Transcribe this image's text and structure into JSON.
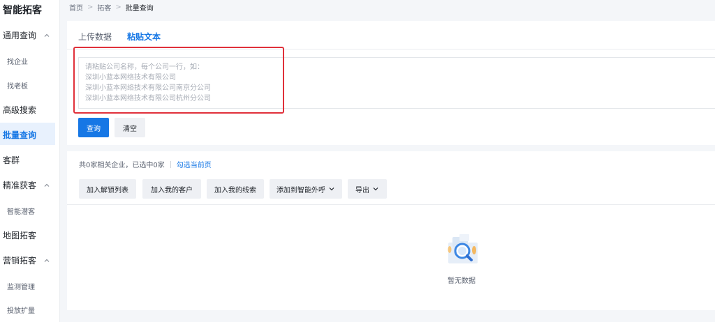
{
  "sidebar": {
    "app_title": "智能拓客",
    "general_query": {
      "label": "通用查询",
      "items": [
        "找企业",
        "找老板"
      ]
    },
    "advanced_search": "高级搜索",
    "batch_query": "批量查询",
    "customer_group": "客群",
    "precise": {
      "label": "精准获客",
      "items": [
        "智能潜客"
      ]
    },
    "map_prospect": "地图拓客",
    "marketing": {
      "label": "营销拓客",
      "items": [
        "监测管理",
        "投放扩量"
      ]
    }
  },
  "breadcrumb": {
    "home": "首页",
    "section": "拓客",
    "current": "批量查询"
  },
  "tabs": {
    "upload": "上传数据",
    "paste": "粘贴文本"
  },
  "paste_area": {
    "placeholder_lines": [
      "请粘贴公司名称，每个公司一行，如：",
      "深圳小蓝本网络技术有限公司",
      "深圳小蓝本网络技术有限公司南京分公司",
      "深圳小蓝本网络技术有限公司杭州分公司"
    ]
  },
  "buttons": {
    "query": "查询",
    "clear": "清空"
  },
  "results": {
    "summary": "共0家相关企业，已选中0家",
    "select_page": "勾选当前页",
    "actions": {
      "add_unlock": "加入解锁列表",
      "add_customer": "加入我的客户",
      "add_lead": "加入我的线索",
      "add_call": "添加到智能外呼",
      "export": "导出"
    },
    "empty_text": "暂无数据"
  },
  "colors": {
    "accent": "#1677e5",
    "highlight": "#e0303a"
  }
}
